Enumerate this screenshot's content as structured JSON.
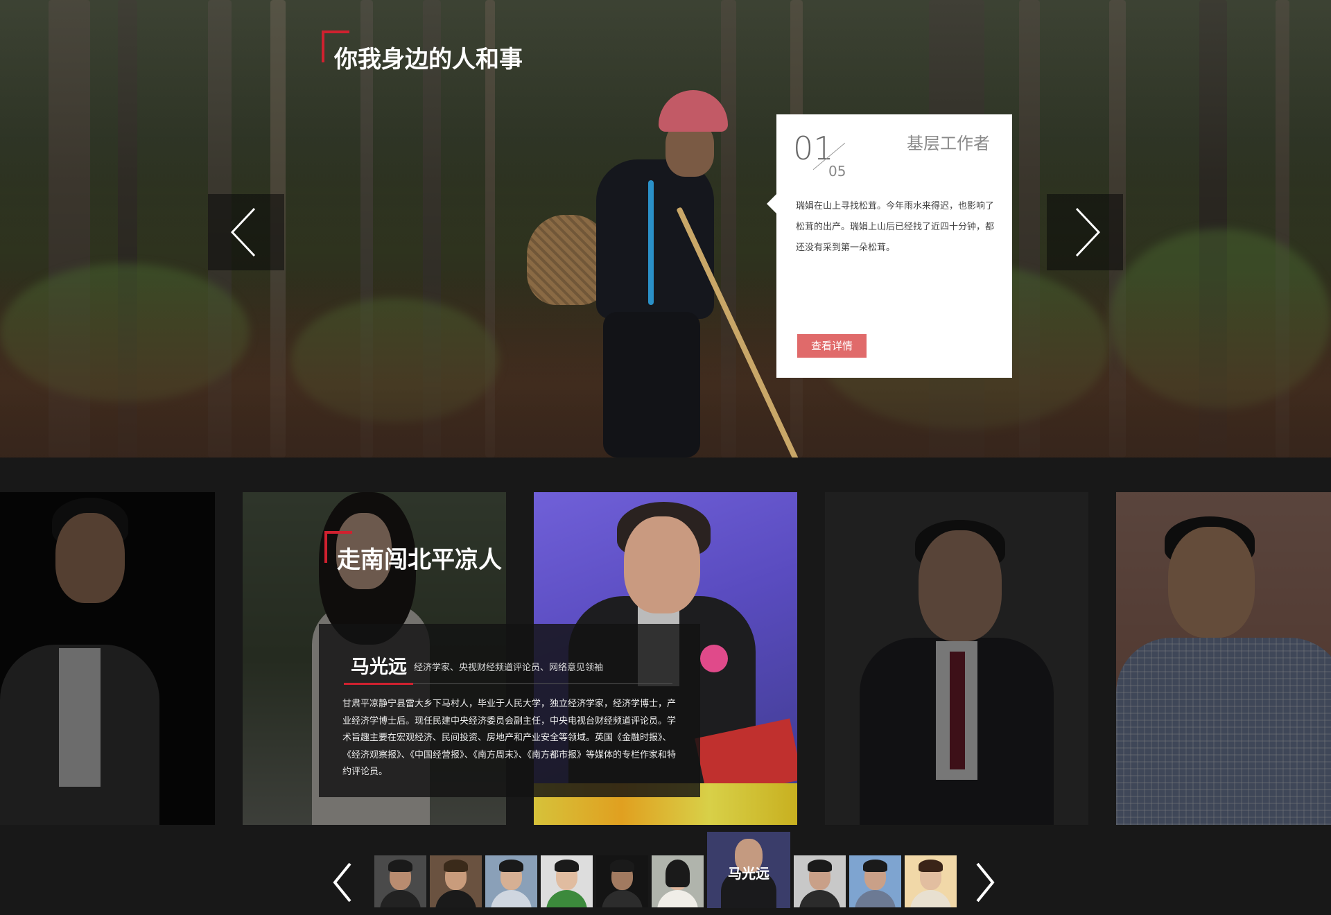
{
  "hero": {
    "title": "你我身边的人和事",
    "card": {
      "index": "01",
      "total": "05",
      "category": "基层工作者",
      "description": "瑞娟在山上寻找松茸。今年雨水来得迟，也影响了松茸的出产。瑞娟上山后已经找了近四十分钟，都还没有采到第一朵松茸。",
      "button_label": "查看详情"
    },
    "prev_icon": "chevron-left-icon",
    "next_icon": "chevron-right-icon"
  },
  "people": {
    "title": "走南闯北平凉人",
    "active": {
      "name": "马光远",
      "title": "经济学家、央视财经频道评论员、网络意见领袖",
      "bio": "甘肃平凉静宁县雷大乡下马村人，毕业于人民大学，独立经济学家，经济学博士，产业经济学博士后。现任民建中央经济委员会副主任，中央电视台财经频道评论员。学术旨趣主要在宏观经济、民间投资、房地产和产业安全等领域。英国《金融时报》、《经济观察报》、《中国经营报》、《南方周末》、《南方都市报》等媒体的专栏作家和特约评论员。"
    },
    "thumb_active_label": "马光远"
  },
  "colors": {
    "accent_red": "#d0212f",
    "button_pink": "#e06a6a",
    "background": "#181818"
  }
}
